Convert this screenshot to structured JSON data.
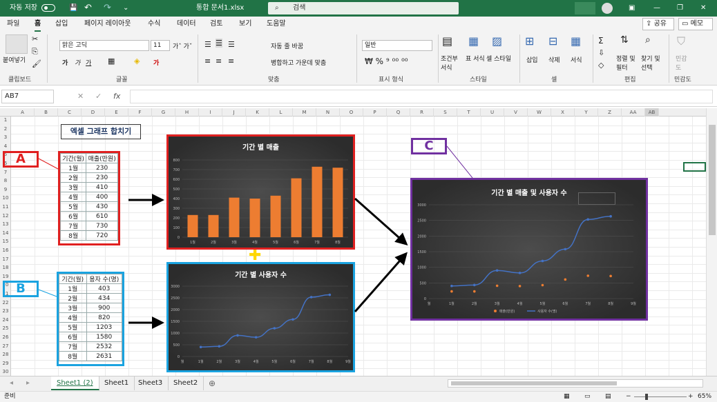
{
  "titlebar": {
    "autosave": "자동 저장",
    "doc_title": "통합 문서1.xlsx",
    "search": "검색"
  },
  "menu": [
    "파일",
    "홈",
    "삽입",
    "페이지 레이아웃",
    "수식",
    "데이터",
    "검토",
    "보기",
    "도움말"
  ],
  "share": "공유",
  "memo": "메모",
  "ribbon": {
    "paste": "붙여넣기",
    "font_name": "맑은 고딕",
    "font_size": "11",
    "wrap": "자동 줄 바꿈",
    "merge": "병합하고 가운데 맞춤",
    "num_format": "일반",
    "cond_fmt": "조건부 서식",
    "table_fmt": "표 서식",
    "cell_style": "셀 스타일",
    "insert": "삽입",
    "delete": "삭제",
    "format": "서식",
    "sort": "정렬 및 필터",
    "find": "찾기 및 선택",
    "sensitivity": "민감도",
    "groups": [
      "클립보드",
      "글꼴",
      "맞춤",
      "표시 형식",
      "스타일",
      "셀",
      "편집",
      "민감도"
    ]
  },
  "namebox": "AB7",
  "columns": [
    "A",
    "B",
    "C",
    "D",
    "E",
    "F",
    "G",
    "H",
    "I",
    "J",
    "K",
    "L",
    "M",
    "N",
    "O",
    "P",
    "Q",
    "R",
    "S",
    "T",
    "U",
    "V",
    "W",
    "X",
    "Y",
    "Z",
    "AA",
    "AB"
  ],
  "rows": [
    "1",
    "2",
    "3",
    "4",
    "5",
    "6",
    "7",
    "8",
    "9",
    "10",
    "11",
    "12",
    "13",
    "14",
    "15",
    "16",
    "17",
    "18",
    "19",
    "20",
    "21",
    "22",
    "23",
    "24",
    "25",
    "26",
    "27",
    "28",
    "29",
    "30"
  ],
  "sheet_title": "엑셀 그래프 합치기",
  "table_a": {
    "headers": [
      "기간(월)",
      "매출(만원)"
    ],
    "months": [
      "1월",
      "2월",
      "3월",
      "4월",
      "5월",
      "6월",
      "7월",
      "8월"
    ],
    "values": [
      "230",
      "230",
      "410",
      "400",
      "430",
      "610",
      "730",
      "720"
    ]
  },
  "table_b": {
    "headers": [
      "기간(월)",
      "용자 수(명)"
    ],
    "months": [
      "1월",
      "2월",
      "3월",
      "4월",
      "5월",
      "6월",
      "7월",
      "8월"
    ],
    "values": [
      "403",
      "434",
      "900",
      "820",
      "1203",
      "1580",
      "2532",
      "2631"
    ]
  },
  "labels": {
    "a": "A",
    "b": "B",
    "c": "C",
    "plus": "✚"
  },
  "colors": {
    "excel_green": "#217346",
    "red": "#e02020",
    "blue": "#1aa3e0",
    "purple": "#7030a0",
    "bar": "#ed7d31",
    "line": "#4472c4"
  },
  "chart_data": [
    {
      "type": "bar",
      "title": "기간 별 매출",
      "categories": [
        "1월",
        "2월",
        "3월",
        "4월",
        "5월",
        "6월",
        "7월",
        "8월"
      ],
      "series": [
        {
          "values": [
            230,
            230,
            410,
            400,
            430,
            610,
            730,
            720
          ]
        }
      ],
      "ylim": [
        0,
        800
      ],
      "yticks": [
        "0",
        "100",
        "200",
        "300",
        "400",
        "500",
        "600",
        "700",
        "800"
      ]
    },
    {
      "type": "line",
      "title": "기간 별 사용자 수",
      "categories": [
        "월",
        "1월",
        "2월",
        "3월",
        "4월",
        "5월",
        "6월",
        "7월",
        "8월",
        "9월"
      ],
      "series": [
        {
          "values": [
            403,
            434,
            900,
            820,
            1203,
            1580,
            2532,
            2631
          ]
        }
      ],
      "ylim": [
        0,
        3000
      ],
      "yticks": [
        "0",
        "500",
        "1000",
        "1500",
        "2000",
        "2500",
        "3000"
      ]
    },
    {
      "type": "line",
      "title": "기간 별 매출 및 사용자 수",
      "categories": [
        "월",
        "1월",
        "2월",
        "3월",
        "4월",
        "5월",
        "6월",
        "7월",
        "8월",
        "9월"
      ],
      "series": [
        {
          "name": "매출(만원)",
          "values": [
            230,
            230,
            410,
            400,
            430,
            610,
            730,
            720
          ]
        },
        {
          "name": "사용자 수(명)",
          "values": [
            403,
            434,
            900,
            820,
            1203,
            1580,
            2532,
            2631
          ]
        }
      ],
      "ylim": [
        0,
        3000
      ],
      "yticks": [
        "0",
        "500",
        "1000",
        "1500",
        "2000",
        "2500",
        "3000"
      ]
    }
  ],
  "sheets": [
    "Sheet1 (2)",
    "Sheet1",
    "Sheet3",
    "Sheet2"
  ],
  "status": {
    "ready": "준비",
    "zoom": "65%"
  }
}
